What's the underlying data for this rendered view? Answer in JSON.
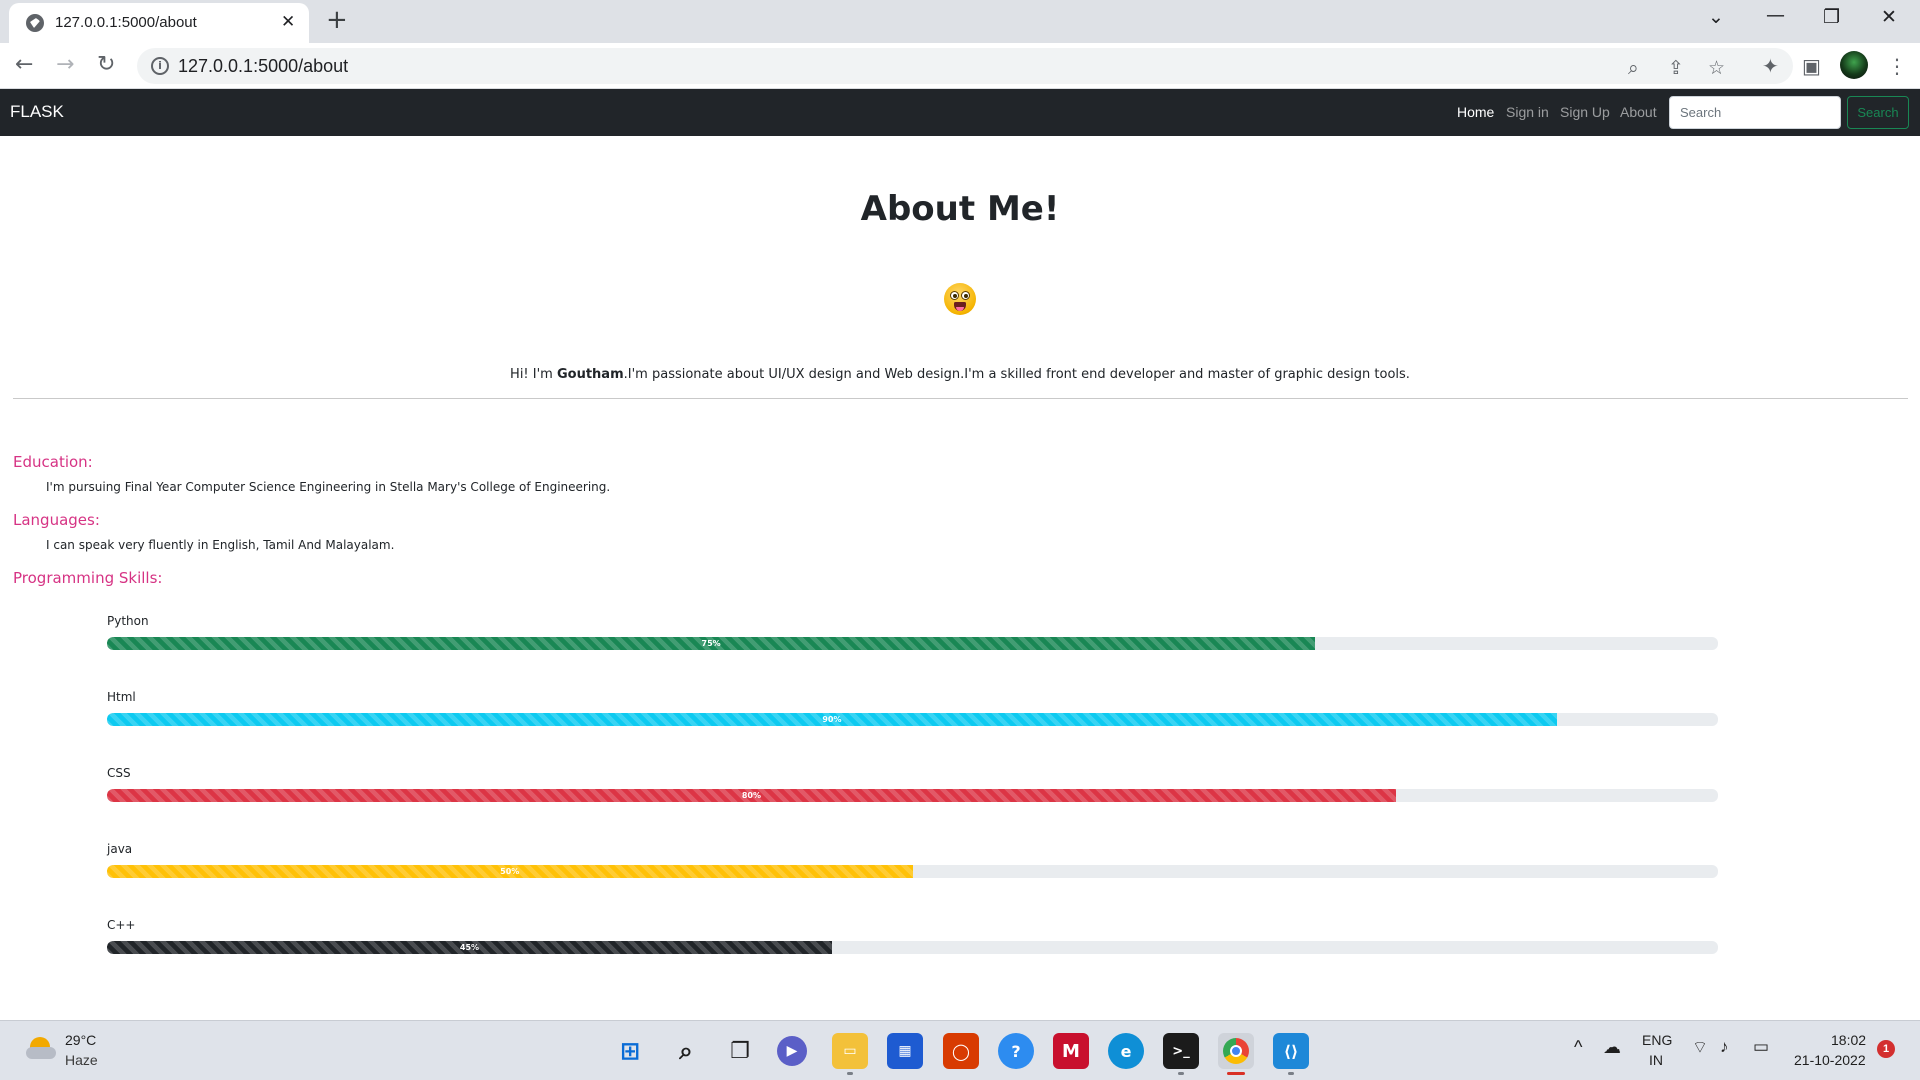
{
  "browser": {
    "tab_title": "127.0.0.1:5000/about",
    "url": "127.0.0.1:5000/about"
  },
  "navbar": {
    "brand": "FLASK",
    "links": [
      {
        "label": "Home",
        "active": true
      },
      {
        "label": "Sign in",
        "active": false
      },
      {
        "label": "Sign Up",
        "active": false
      },
      {
        "label": "About",
        "active": false
      }
    ],
    "search_placeholder": "Search",
    "search_button": "Search"
  },
  "page": {
    "heading": "About Me!",
    "emoji": "grinning-face-emoji",
    "intro_prefix": "Hi! I'm ",
    "intro_name": "Goutham",
    "intro_suffix": ".I'm passionate about UI/UX design and Web design.I'm a skilled front end developer and master of graphic design tools.",
    "education_title": "Education:",
    "education_text": "I'm pursuing Final Year Computer Science Engineering in Stella Mary's College of Engineering.",
    "languages_title": "Languages:",
    "languages_text": "I can speak very fluently in English, Tamil And Malayalam.",
    "skills_title": "Programming Skills:",
    "skills": [
      {
        "name": "Python",
        "percent": 75,
        "label": "75%",
        "color": "#198754"
      },
      {
        "name": "Html",
        "percent": 90,
        "label": "90%",
        "color": "#0dcaf0"
      },
      {
        "name": "CSS",
        "percent": 80,
        "label": "80%",
        "color": "#dc3545"
      },
      {
        "name": "java",
        "percent": 50,
        "label": "50%",
        "color": "#ffc107"
      },
      {
        "name": "C++",
        "percent": 45,
        "label": "45%",
        "color": "#212529"
      }
    ]
  },
  "taskbar": {
    "weather_temp": "29°C",
    "weather_condition": "Haze",
    "language_primary": "ENG",
    "language_region": "IN",
    "time": "18:02",
    "date": "21-10-2022",
    "notification_count": "1"
  }
}
